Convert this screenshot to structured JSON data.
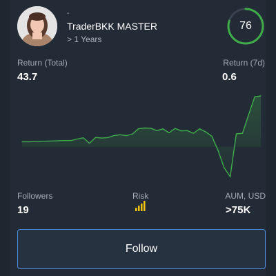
{
  "trader": {
    "badge_dot": "-",
    "name": "TraderBKK MASTER",
    "tenure": "> 1 Years",
    "score": 76,
    "score_fraction": 0.8
  },
  "stats": {
    "return_total_label": "Return (Total)",
    "return_total_value": "43.7",
    "return_7d_label": "Return (7d)",
    "return_7d_value": "0.6",
    "followers_label": "Followers",
    "followers_value": "19",
    "risk_label": "Risk",
    "risk_icon": "signal-bars-icon",
    "aum_label": "AUM, USD",
    "aum_value": ">75K"
  },
  "colors": {
    "accent_green": "#3fae49",
    "risk_yellow": "#f1c40f",
    "button_border": "#4c8fdb"
  },
  "chart_data": {
    "type": "area",
    "y": [
      5.0,
      5.0,
      5.2,
      5.5,
      5.6,
      5.8,
      6.1,
      6.2,
      6.2,
      7.7,
      9.0,
      3.5,
      9.3,
      8.7,
      9.2,
      11.2,
      12.0,
      11.2,
      12.6,
      18.0,
      18.8,
      18.6,
      16.2,
      17.9,
      14.0,
      18.3,
      15.9,
      16.2,
      13.5,
      18.0,
      14.9,
      10.5,
      -3.5,
      -21.0,
      -30.0,
      13.0,
      13.5,
      32.0,
      50.0,
      51.0
    ]
  },
  "follow_button": {
    "label": "Follow"
  }
}
